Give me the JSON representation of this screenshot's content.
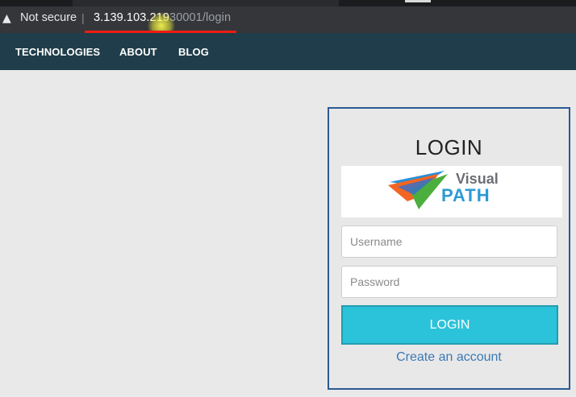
{
  "browser": {
    "security_label": "Not secure",
    "separator": "|",
    "url_host": "3.139.103.219",
    "url_rest": "30001/login"
  },
  "nav": {
    "items": [
      {
        "label": "TECHNOLOGIES"
      },
      {
        "label": "ABOUT"
      },
      {
        "label": "BLOG"
      }
    ]
  },
  "login": {
    "title": "LOGIN",
    "logo": {
      "line1": "Visual",
      "line2": "PATH"
    },
    "username_placeholder": "Username",
    "password_placeholder": "Password",
    "submit_label": "LOGIN",
    "create_account": "Create an account"
  },
  "colors": {
    "nav_bg": "#1f3d4a",
    "panel_border": "#2b5a94",
    "button": "#2bc3d9",
    "link": "#3a79b5"
  }
}
